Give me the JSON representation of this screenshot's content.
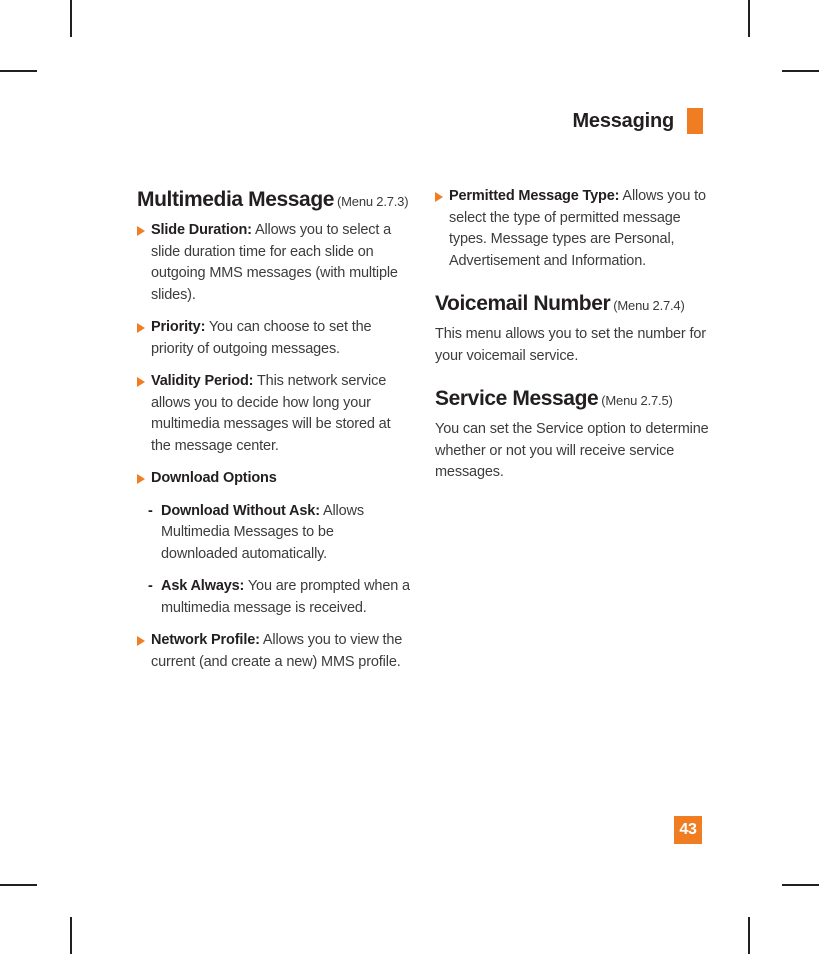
{
  "page": {
    "number": "43",
    "running_header": "Messaging",
    "accent_color": "#f07d22",
    "text_color": "#3c3c3c",
    "heading_color": "#231f20"
  },
  "left_column": {
    "section": {
      "title": "Multimedia Message",
      "menu_ref": "(Menu 2.7.3)"
    },
    "bullets": [
      {
        "lead": "Slide Duration:",
        "text": " Allows you to select a slide duration time for each slide on outgoing MMS messages (with multiple slides)."
      },
      {
        "lead": "Priority:",
        "text": " You can choose to set the priority of outgoing messages."
      },
      {
        "lead": "Validity Period:",
        "text": " This network service allows you to decide how long your multimedia messages will be stored at the message center."
      },
      {
        "lead": "Download Options",
        "text": ""
      }
    ],
    "subitems": [
      {
        "dash": "-",
        "lead": "Download Without Ask:",
        "text": " Allows Multimedia Messages to be downloaded automatically."
      },
      {
        "dash": "-",
        "lead": "Ask Always:",
        "text": " You are prompted when a multimedia message is received."
      }
    ],
    "bullet_last": {
      "lead": "Network Profile:",
      "text": " Allows you to view the current (and create a new) MMS profile."
    }
  },
  "right_column": {
    "bullet_permitted": {
      "lead": "Permitted Message Type:",
      "text": " Allows you to select the type of permitted message types. Message types are Personal, Advertisement and Information."
    },
    "voicemail": {
      "title": "Voicemail Number",
      "menu_ref": "(Menu 2.7.4)",
      "body": "This menu allows you to set the number for your voicemail service."
    },
    "service_message": {
      "title": "Service Message",
      "menu_ref": "(Menu 2.7.5)",
      "body": "You can set the Service option to determine whether or not you will receive service messages."
    }
  }
}
